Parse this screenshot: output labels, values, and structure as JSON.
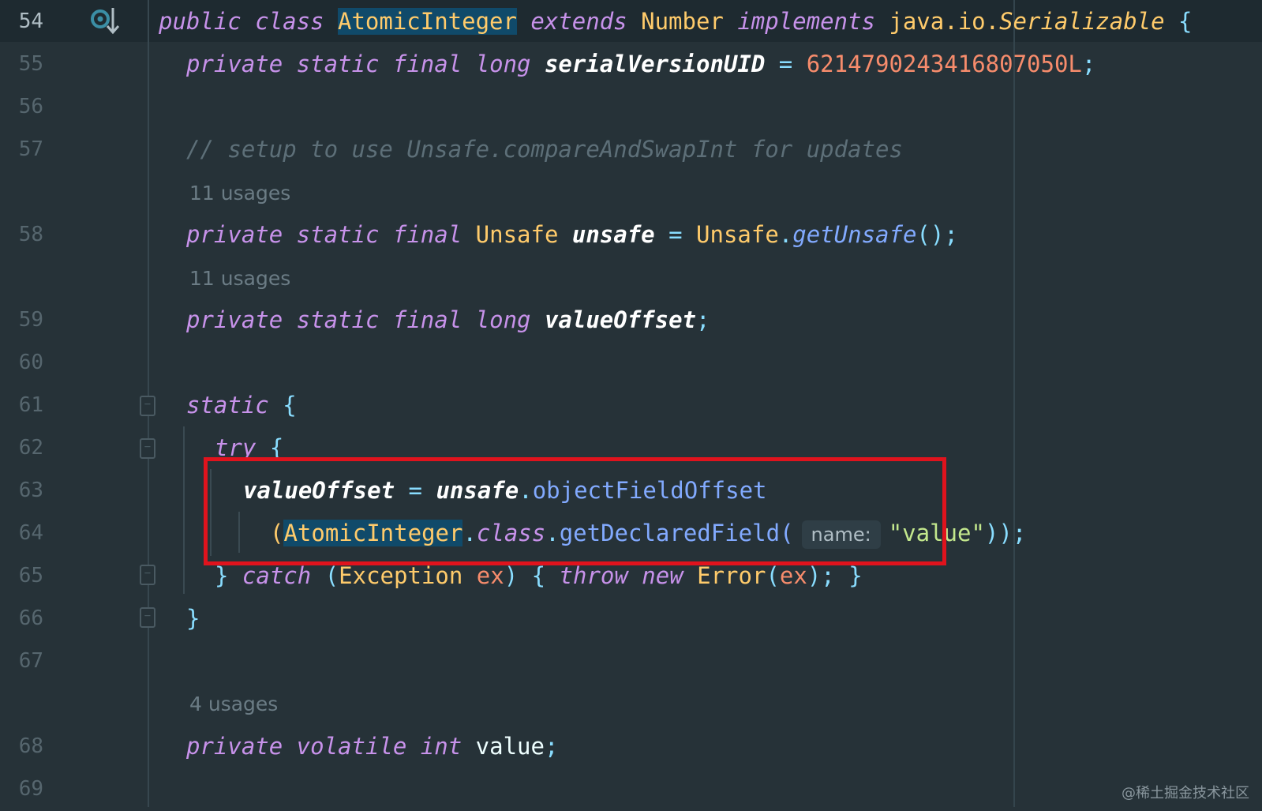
{
  "editor": {
    "language": "Java",
    "theme_colors": {
      "background": "#263238",
      "keyword": "#c792ea",
      "type": "#ffcb6b",
      "number": "#f78c6c",
      "method": "#82aaff",
      "string": "#c3e88d",
      "comment": "#5d6f78",
      "highlight_box": "#e0131d"
    },
    "gutter_icon": "implementation-arrow-icon"
  },
  "lines": {
    "l54": {
      "num": "54",
      "t1": "public class ",
      "t2": "AtomicInteger",
      "t3": " extends ",
      "t4": "Number",
      "t5": " implements ",
      "t6": "java.io.",
      "t7": "Serializable",
      "t8": " {"
    },
    "l55": {
      "num": "55",
      "t1": "private static final long ",
      "t2": "serialVersionUID",
      "t3": " = ",
      "t4": "6214790243416807050L",
      "t5": ";"
    },
    "l56": {
      "num": "56"
    },
    "l57": {
      "num": "57",
      "t1": "// setup to use Unsafe.compareAndSwapInt for updates"
    },
    "u58": {
      "text": "11 usages"
    },
    "l58": {
      "num": "58",
      "t1": "private static final ",
      "t2": "Unsafe",
      "t3": " unsafe",
      "t4": " = ",
      "t5": "Unsafe",
      "t6": ".",
      "t7": "getUnsafe",
      "t8": "();"
    },
    "u59": {
      "text": "11 usages"
    },
    "l59": {
      "num": "59",
      "t1": "private static final long ",
      "t2": "valueOffset",
      "t3": ";"
    },
    "l60": {
      "num": "60"
    },
    "l61": {
      "num": "61",
      "t1": "static",
      "t2": " {"
    },
    "l62": {
      "num": "62",
      "t1": "try",
      "t2": " {"
    },
    "l63": {
      "num": "63",
      "t1": "valueOffset",
      "t2": " = ",
      "t3": "unsafe",
      "t4": ".",
      "t5": "objectFieldOffset"
    },
    "l64": {
      "num": "64",
      "t1": "(",
      "t2": "AtomicInteger",
      "t3": ".",
      "t4": "class",
      "t5": ".",
      "t6": "getDeclaredField",
      "t7": "(",
      "hint": "name:",
      "t8": "\"value\"",
      "t9": "));"
    },
    "l65": {
      "num": "65",
      "t1": "} ",
      "t2": "catch",
      "t3": " (",
      "t4": "Exception",
      "t5": " ex",
      "t6": ") { ",
      "t7": "throw new ",
      "t8": "Error",
      "t9": "(",
      "t10": "ex",
      "t11": "); }"
    },
    "l66": {
      "num": "66",
      "t1": "}"
    },
    "l67": {
      "num": "67"
    },
    "u68": {
      "text": "4 usages"
    },
    "l68": {
      "num": "68",
      "t1": "private volatile int ",
      "t2": "value",
      "t3": ";"
    },
    "l69": {
      "num": "69"
    }
  },
  "watermark": "@稀土掘金技术社区"
}
